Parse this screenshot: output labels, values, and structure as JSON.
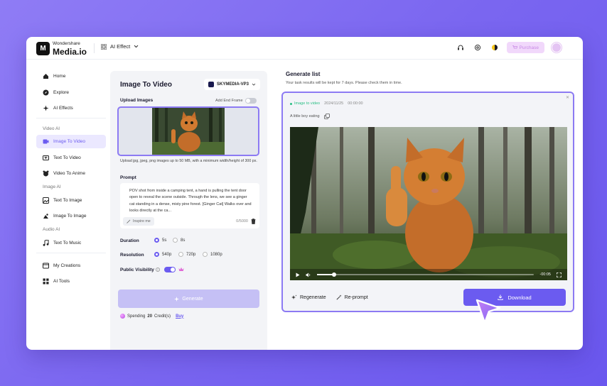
{
  "brand": {
    "top": "Wondershare",
    "main": "Media.io",
    "logo_letter": "M"
  },
  "header": {
    "menu_label": "AI Effect",
    "purchase_label": "Purchase"
  },
  "sidebar": {
    "items": [
      {
        "label": "Home",
        "icon": "home-icon"
      },
      {
        "label": "Explore",
        "icon": "compass-icon"
      },
      {
        "label": "AI Effects",
        "icon": "sparkle-icon"
      }
    ],
    "sections": [
      {
        "title": "Video AI",
        "items": [
          {
            "label": "Image To Video",
            "icon": "image-video-icon",
            "active": true
          },
          {
            "label": "Text To Video",
            "icon": "text-video-icon"
          },
          {
            "label": "Video To Anime",
            "icon": "anime-icon"
          }
        ]
      },
      {
        "title": "Image AI",
        "items": [
          {
            "label": "Text To Image",
            "icon": "text-image-icon"
          },
          {
            "label": "Image To Image",
            "icon": "image-image-icon"
          }
        ]
      },
      {
        "title": "Audio AI",
        "items": [
          {
            "label": "Text To Music",
            "icon": "music-icon"
          }
        ]
      }
    ],
    "bottom": [
      {
        "label": "My Creations",
        "icon": "creations-icon"
      },
      {
        "label": "AI Tools",
        "icon": "tools-icon"
      }
    ]
  },
  "panel": {
    "title": "Image To Video",
    "model": "SKYMEDIA-VP3",
    "upload_label": "Upload Images",
    "end_frame_label": "Add End Frame",
    "upload_help": "Upload jpg, jpeg, png images up to 50 MB, with a minimum width/height of 300 px.",
    "prompt_label": "Prompt",
    "prompt_text": "POV shot from inside a camping tent, a hand is pulling the tent door open to reveal the scene outside. Through the lens, we see a ginger cat standing in a dense, misty pine forest. [Ginger Cat] Walks over and looks directly at the ca...",
    "inspire_label": "Inspire me",
    "char_count": "0/5000",
    "duration_label": "Duration",
    "durations": [
      "5s",
      "8s"
    ],
    "resolution_label": "Resolution",
    "resolutions": [
      "540p",
      "720p",
      "1080p"
    ],
    "visibility_label": "Public Visibility",
    "generate_label": "Generate",
    "spending_prefix": "Spending",
    "spending_amount": "20",
    "spending_suffix": "Credit(s)",
    "buy_label": "Buy"
  },
  "generate": {
    "title": "Generate list",
    "subtitle": "Your task results will be kept for 7 days. Please check them in time.",
    "item": {
      "tag": "Image to video",
      "date": "2024/11/25",
      "time": "00:00:00",
      "description": "A little boy eating",
      "video_time": "-00:05",
      "progress": 0.08
    },
    "regenerate_label": "Regenerate",
    "reprompt_label": "Re-prompt",
    "download_label": "Download"
  },
  "colors": {
    "accent": "#6b5bf0",
    "success": "#2bbf85",
    "background": "#7a66f0"
  }
}
